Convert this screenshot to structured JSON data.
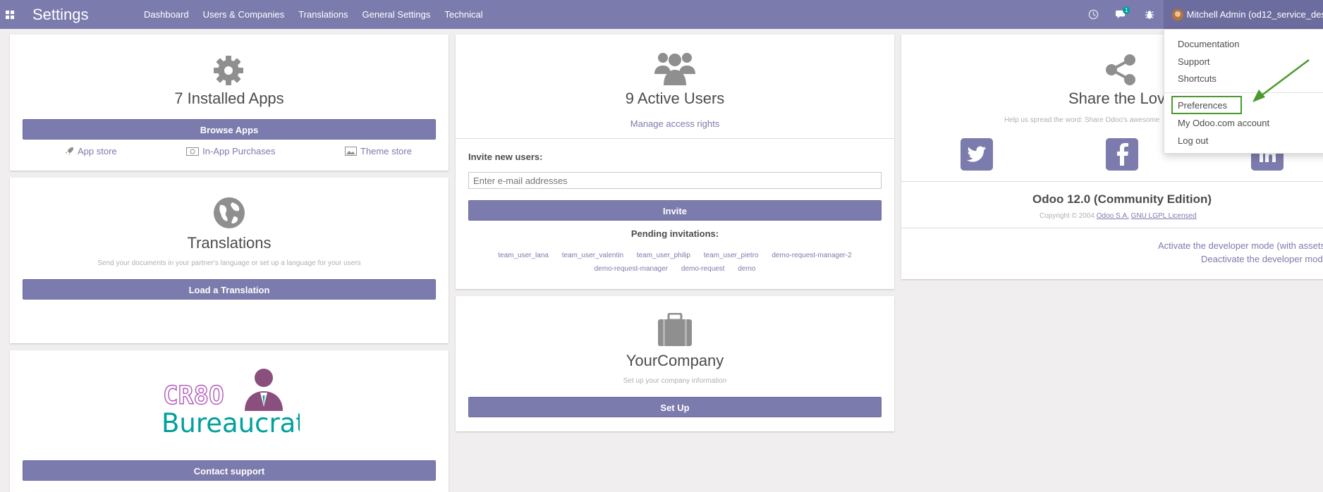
{
  "topbar": {
    "brand": "Settings",
    "menu": [
      "Dashboard",
      "Users & Companies",
      "Translations",
      "General Settings",
      "Technical"
    ],
    "chat_badge": "1",
    "user_name": "Mitchell Admin (od12_service_des"
  },
  "apps_card": {
    "title": "7 Installed Apps",
    "button": "Browse Apps",
    "links": [
      "App store",
      "In-App Purchases",
      "Theme store"
    ]
  },
  "translations_card": {
    "title": "Translations",
    "description": "Send your documents in your partner's language or set up a language for your users",
    "button": "Load a Translation"
  },
  "support_card": {
    "logo_text": "CR8O",
    "logo_word": "Bureaucrat",
    "button": "Contact support"
  },
  "users_card": {
    "title": "9 Active Users",
    "link": "Manage access rights",
    "invite_label": "Invite new users:",
    "invite_placeholder": "Enter e-mail addresses",
    "invite_button": "Invite",
    "pending_title": "Pending invitations:",
    "pending_row1": [
      "team_user_lana",
      "team_user_valentin",
      "team_user_philip",
      "team_user_pietro",
      "demo-request-manager-2"
    ],
    "pending_row2": [
      "demo-request-manager",
      "demo-request",
      "demo"
    ]
  },
  "company_card": {
    "title": "YourCompany",
    "description": "Set up your company information",
    "button": "Set Up"
  },
  "share_card": {
    "title": "Share the Lov",
    "description": "Help us spread the word: Share Odoo's awesome",
    "version": "Odoo 12.0 (Community Edition)",
    "copyright_prefix": "Copyright © 2004",
    "copyright_company": "Odoo S.A.",
    "license": "GNU LGPL Licensed",
    "dev_activate": "Activate the developer mode (with assets",
    "dev_deactivate": "Deactivate the developer mod"
  },
  "user_dropdown": {
    "items": [
      "Documentation",
      "Support",
      "Shortcuts",
      "Preferences",
      "My Odoo.com account",
      "Log out"
    ]
  },
  "colors": {
    "primary": "#7c7bad",
    "topbar": "#7c7bad",
    "highlight": "#4a9a2c",
    "logo_teal": "#00a09d",
    "logo_purple": "#8a4f7d"
  }
}
